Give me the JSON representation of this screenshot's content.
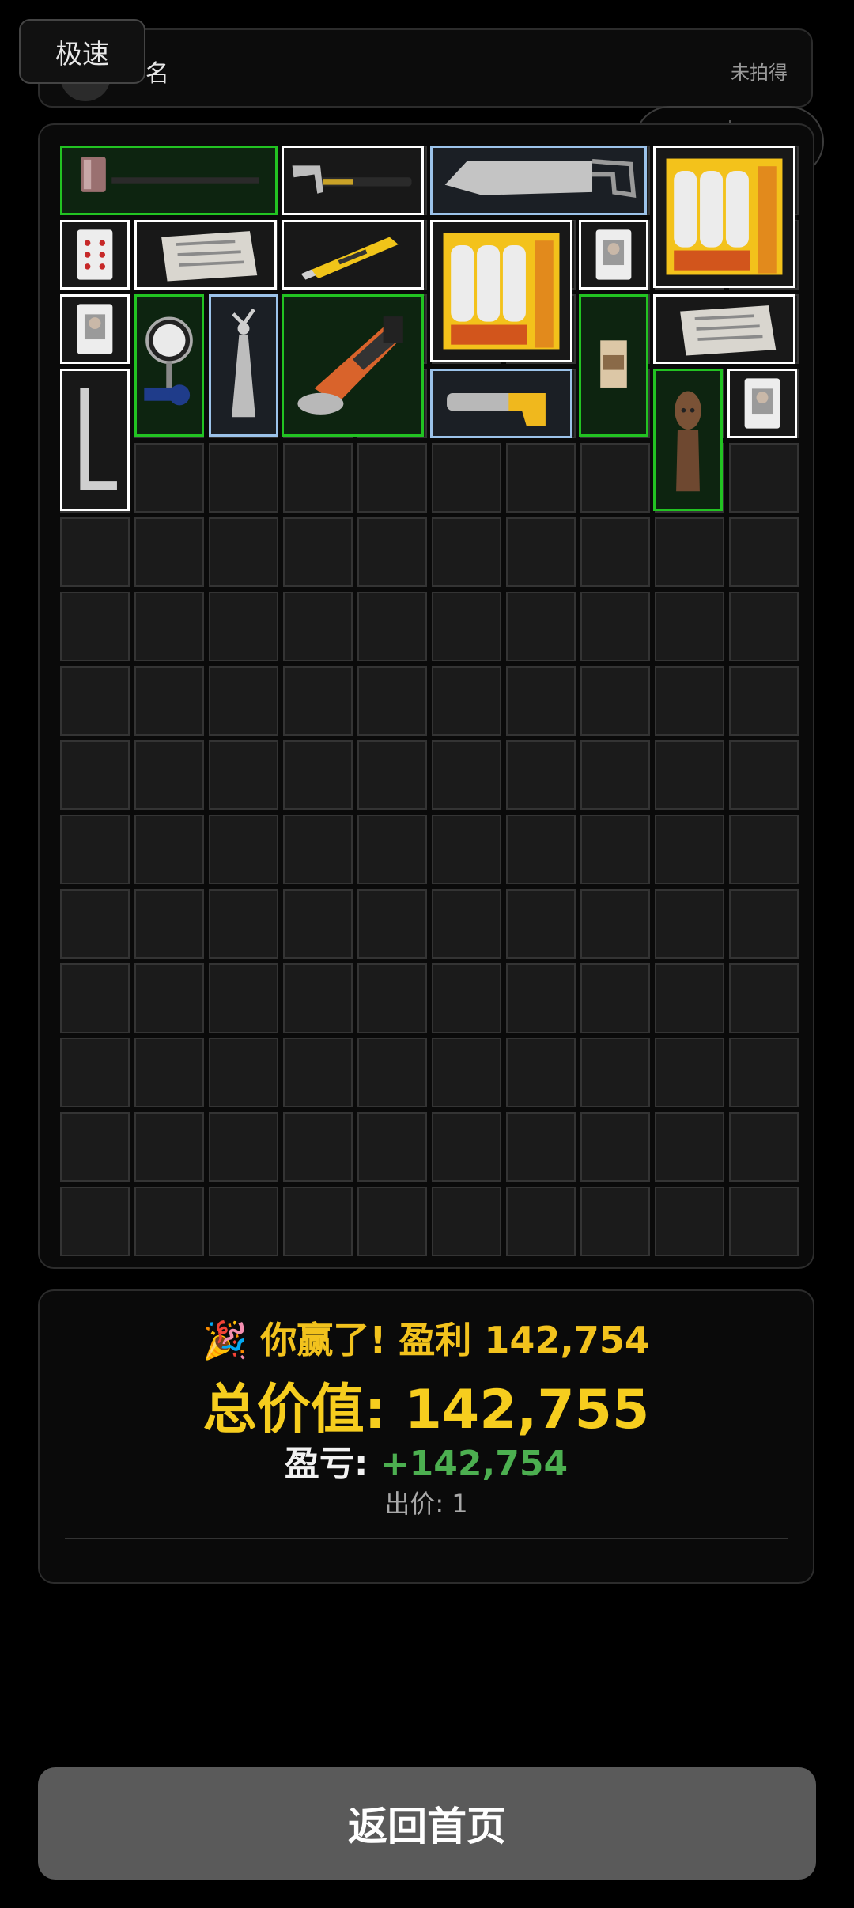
{
  "header": {
    "name": "名",
    "status": "未拍得"
  },
  "speed_button": {
    "label": "极速"
  },
  "capsule": {
    "more_icon": "more-dots-icon",
    "close_icon": "target-icon"
  },
  "inventory": {
    "columns": 10,
    "rows": 15,
    "items": [
      {
        "name": "sledgehammer",
        "rarity": "green"
      },
      {
        "name": "claw-hammer",
        "rarity": "white"
      },
      {
        "name": "hand-saw",
        "rarity": "blue"
      },
      {
        "name": "candle-pack",
        "rarity": "white"
      },
      {
        "name": "playing-card-hearts",
        "rarity": "white"
      },
      {
        "name": "old-newspaper",
        "rarity": "white"
      },
      {
        "name": "utility-knife",
        "rarity": "white"
      },
      {
        "name": "candle-pack",
        "rarity": "white"
      },
      {
        "name": "playing-card-portrait",
        "rarity": "white"
      },
      {
        "name": "playing-card-portrait",
        "rarity": "white"
      },
      {
        "name": "pressure-gauge-valve",
        "rarity": "green"
      },
      {
        "name": "dancer-figurine",
        "rarity": "blue"
      },
      {
        "name": "angle-grinder",
        "rarity": "green"
      },
      {
        "name": "coffee-bag",
        "rarity": "green"
      },
      {
        "name": "old-newspaper",
        "rarity": "white"
      },
      {
        "name": "carpenter-square",
        "rarity": "white"
      },
      {
        "name": "heat-gun",
        "rarity": "blue"
      },
      {
        "name": "wooden-idol",
        "rarity": "green"
      },
      {
        "name": "playing-card-portrait",
        "rarity": "white"
      }
    ]
  },
  "result": {
    "party_icon": "party-popper-icon",
    "win_text": "🎉 你赢了! 盈利 142,754",
    "total_label": "总价值: ",
    "total_value": "142,755",
    "pl_label": "盈亏: ",
    "pl_value": "+142,754",
    "bid_text": "出价: 1"
  },
  "home_button": {
    "label": "返回首页"
  },
  "colors": {
    "background": "#000000",
    "gold": "#f6cd1e",
    "profit_green": "#4caf50",
    "rarity_green": "#22c322",
    "rarity_blue": "#9cc3ea",
    "rarity_white": "#ffffff"
  }
}
